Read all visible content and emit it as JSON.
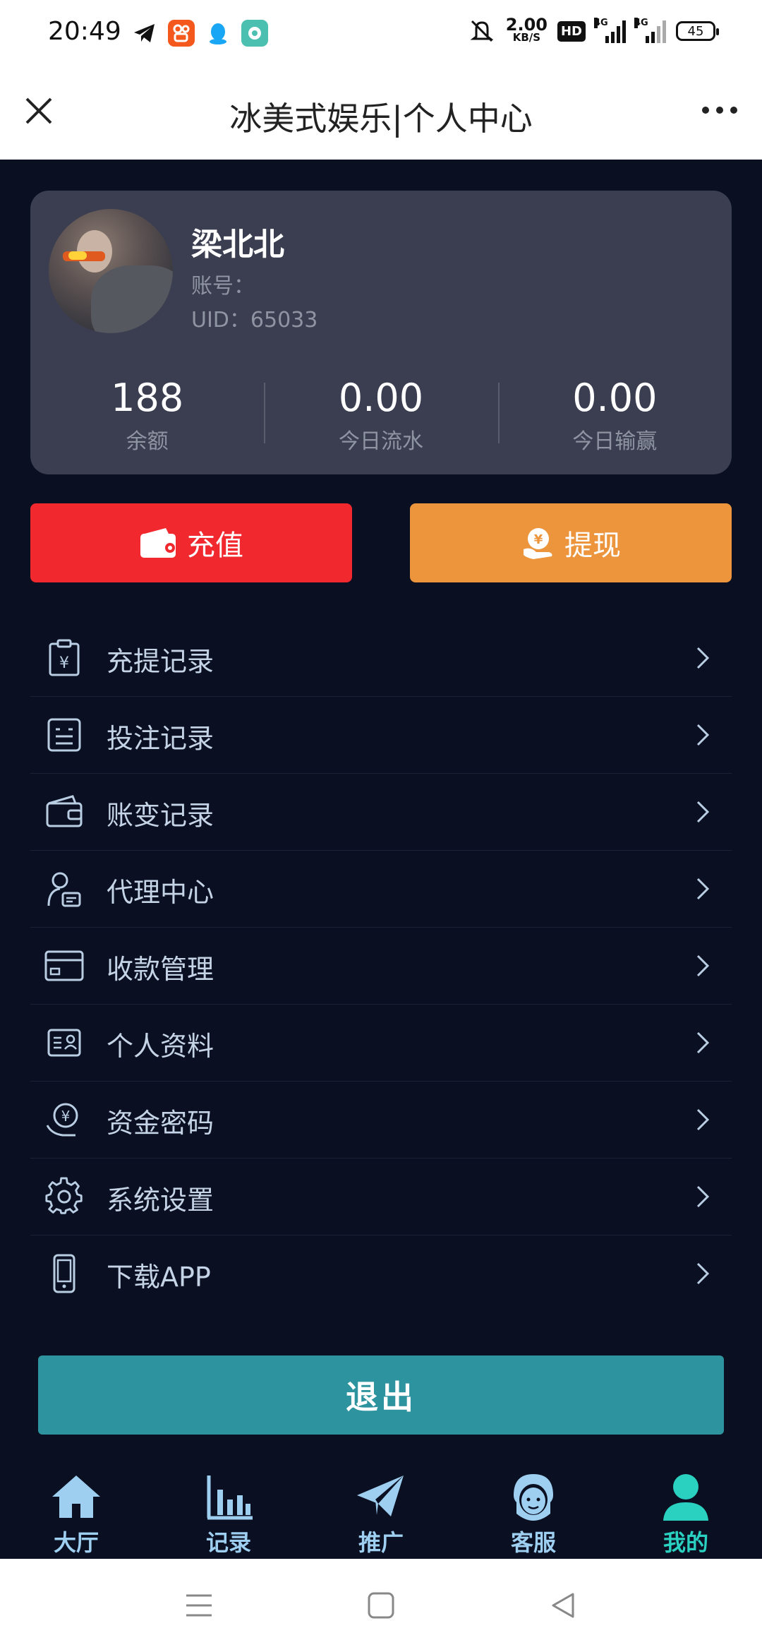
{
  "status_bar": {
    "time": "20:49",
    "speed_value": "2.00",
    "speed_unit": "KB/S",
    "hd_badge": "HD",
    "signal1_label": "4G",
    "signal2_label": "4G",
    "battery": "45"
  },
  "title_bar": {
    "title": "冰美式娱乐|个人中心"
  },
  "profile": {
    "name": "梁北北",
    "account": "账号：",
    "uid": "UID：65033",
    "stats": [
      {
        "value": "188",
        "label": "余额"
      },
      {
        "value": "0.00",
        "label": "今日流水"
      },
      {
        "value": "0.00",
        "label": "今日输赢"
      }
    ]
  },
  "actions": {
    "recharge": "充值",
    "withdraw": "提现"
  },
  "menu": {
    "items": [
      {
        "label": "充提记录",
        "icon": "clipboard-yuan-icon"
      },
      {
        "label": "投注记录",
        "icon": "betting-list-icon"
      },
      {
        "label": "账变记录",
        "icon": "wallet-icon"
      },
      {
        "label": "代理中心",
        "icon": "agent-icon"
      },
      {
        "label": "收款管理",
        "icon": "card-icon"
      },
      {
        "label": "个人资料",
        "icon": "id-card-icon"
      },
      {
        "label": "资金密码",
        "icon": "yuan-hand-icon"
      },
      {
        "label": "系统设置",
        "icon": "gear-icon"
      },
      {
        "label": "下载APP",
        "icon": "phone-icon"
      }
    ]
  },
  "logout": "退出",
  "bottom_nav": {
    "items": [
      {
        "label": "大厅",
        "icon": "home-icon"
      },
      {
        "label": "记录",
        "icon": "bar-chart-icon"
      },
      {
        "label": "推广",
        "icon": "paper-plane-icon"
      },
      {
        "label": "客服",
        "icon": "customer-service-icon"
      },
      {
        "label": "我的",
        "icon": "user-icon",
        "active": true
      }
    ]
  },
  "colors": {
    "background": "#0a0f22",
    "card": "#3b3e50",
    "recharge": "#f1282d",
    "withdraw": "#ec953c",
    "logout": "#2d949f",
    "nav_active": "#2ad0c0",
    "nav_inactive": "#9ecff0"
  }
}
